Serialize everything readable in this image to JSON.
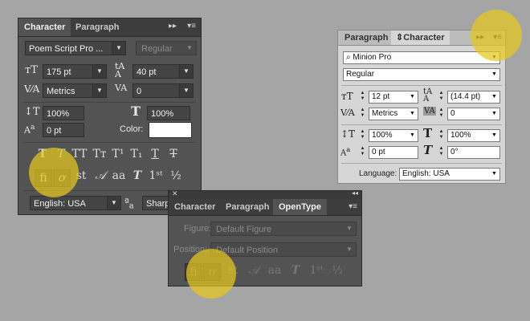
{
  "panel1": {
    "tabs": [
      "Character",
      "Paragraph"
    ],
    "font_family": "Poem Script Pro ...",
    "font_style": "Regular",
    "size": "175 pt",
    "leading": "40 pt",
    "kerning": "Metrics",
    "tracking": "0",
    "vertical_scale": "100%",
    "horizontal_scale": "100%",
    "baseline_shift": "0 pt",
    "color_label": "Color:",
    "language": "English: USA",
    "antialias": "Sharp"
  },
  "panel2": {
    "tabs": [
      "Paragraph",
      "Character"
    ],
    "font_family": "Minion Pro",
    "font_style": "Regular",
    "size": "12 pt",
    "leading": "(14.4 pt)",
    "kerning": "Metrics",
    "tracking": "0",
    "vertical_scale": "100%",
    "horizontal_scale": "100%",
    "baseline_shift": "0 pt",
    "skew": "0°",
    "language_label": "Language:",
    "language": "English: USA"
  },
  "panel3": {
    "tabs": [
      "Character",
      "Paragraph",
      "OpenType"
    ],
    "figure_label": "Figure:",
    "figure": "Default Figure",
    "position_label": "Position:",
    "position": "Default Position"
  },
  "colors": {
    "highlight": "#e8c81e",
    "dark_panel": "#535353",
    "light_panel": "#d6d6d6"
  }
}
